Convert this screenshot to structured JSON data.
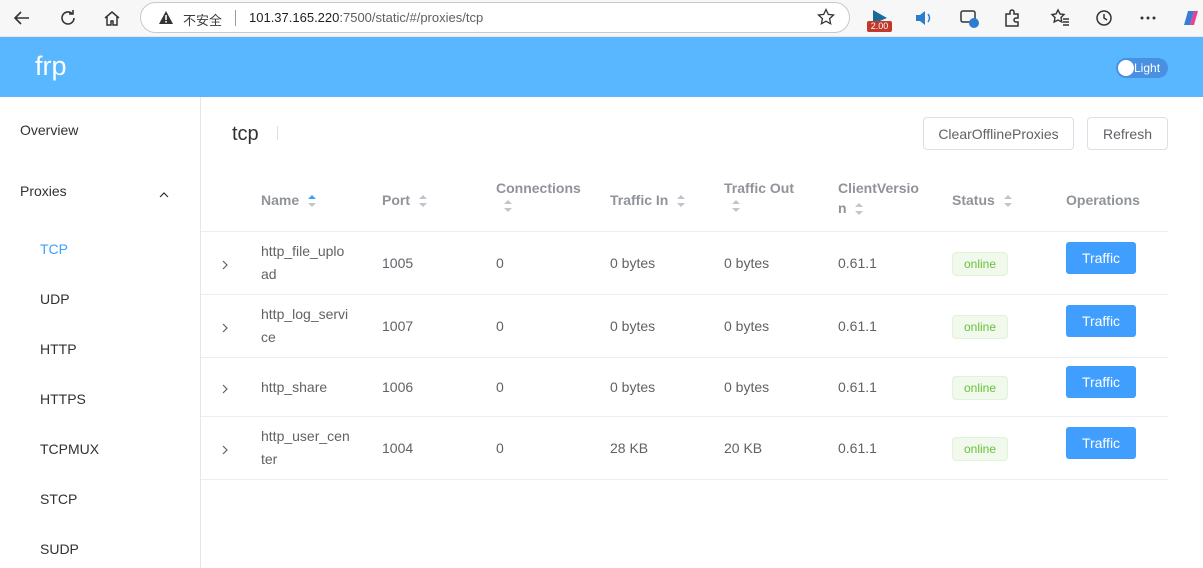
{
  "browser": {
    "insecure_label": "不安全",
    "url_host": "101.37.165.220",
    "url_rest": ":7500/static/#/proxies/tcp",
    "ext_badge": "2.00"
  },
  "header": {
    "logo": "frp",
    "theme_label": "Light"
  },
  "sidebar": {
    "overview": "Overview",
    "proxies": "Proxies",
    "items": [
      {
        "label": "TCP",
        "active": true
      },
      {
        "label": "UDP"
      },
      {
        "label": "HTTP"
      },
      {
        "label": "HTTPS"
      },
      {
        "label": "TCPMUX"
      },
      {
        "label": "STCP"
      },
      {
        "label": "SUDP"
      }
    ]
  },
  "main": {
    "title": "tcp",
    "clear_button": "ClearOfflineProxies",
    "refresh_button": "Refresh"
  },
  "table": {
    "columns": {
      "name": "Name",
      "port": "Port",
      "connections": "Connections",
      "traffic_in": "Traffic In",
      "traffic_out": "Traffic Out",
      "client_version_1": "ClientVersio",
      "client_version_2": "n",
      "status": "Status",
      "operations": "Operations"
    },
    "rows": [
      {
        "name_1": "http_file_uplo",
        "name_2": "ad",
        "port": "1005",
        "connections": "0",
        "traffic_in": "0 bytes",
        "traffic_out": "0 bytes",
        "version": "0.61.1",
        "status": "online",
        "action": "Traffic"
      },
      {
        "name_1": "http_log_servi",
        "name_2": "ce",
        "port": "1007",
        "connections": "0",
        "traffic_in": "0 bytes",
        "traffic_out": "0 bytes",
        "version": "0.61.1",
        "status": "online",
        "action": "Traffic"
      },
      {
        "name_1": "http_share",
        "name_2": "",
        "port": "1006",
        "connections": "0",
        "traffic_in": "0 bytes",
        "traffic_out": "0 bytes",
        "version": "0.61.1",
        "status": "online",
        "action": "Traffic"
      },
      {
        "name_1": "http_user_cen",
        "name_2": "ter",
        "port": "1004",
        "connections": "0",
        "traffic_in": "28 KB",
        "traffic_out": "20 KB",
        "version": "0.61.1",
        "status": "online",
        "action": "Traffic"
      }
    ]
  },
  "colors": {
    "header_bg": "#58b7ff",
    "primary": "#409eff",
    "online_text": "#67c23a",
    "online_bg": "#f0f9eb"
  }
}
